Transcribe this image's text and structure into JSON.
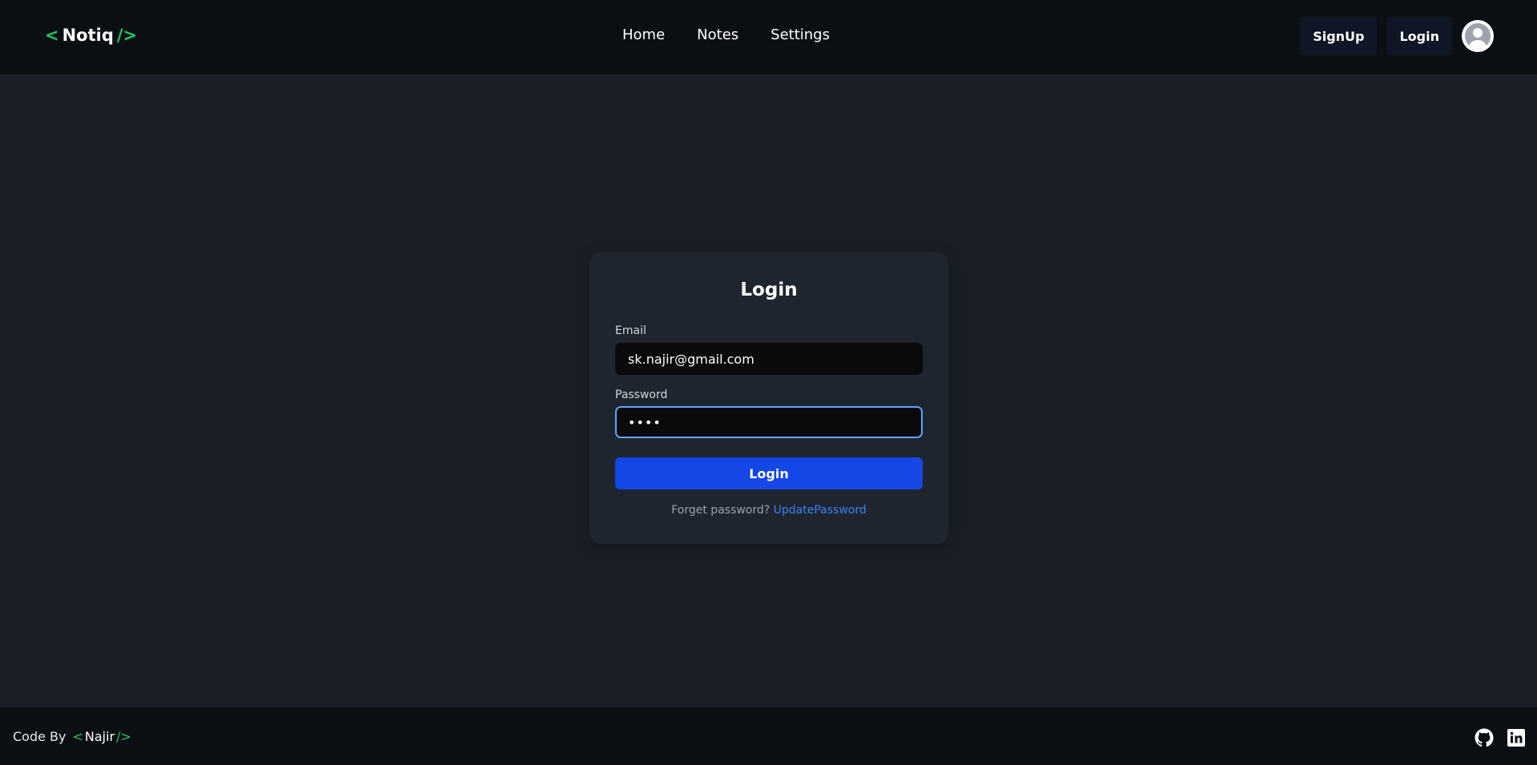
{
  "header": {
    "brand": {
      "open": "<",
      "name": "Notiq",
      "close": "/>"
    },
    "nav": [
      {
        "label": "Home"
      },
      {
        "label": "Notes"
      },
      {
        "label": "Settings"
      }
    ],
    "signup_label": "SignUp",
    "login_label": "Login"
  },
  "card": {
    "title": "Login",
    "email_label": "Email",
    "email_value": "sk.najir@gmail.com",
    "password_label": "Password",
    "password_value": "••••",
    "submit_label": "Login",
    "forgot_text": "Forget password?",
    "forgot_link": "UpdatePassword"
  },
  "footer": {
    "code_by": "Code By",
    "signature": {
      "open": "<",
      "name": "Najir",
      "close": "/>"
    },
    "icons": [
      "github-icon",
      "linkedin-icon"
    ]
  },
  "colors": {
    "accent": "#22c55e",
    "primary": "#1546e6",
    "link": "#3b82f6",
    "focus": "#60a5fa"
  }
}
